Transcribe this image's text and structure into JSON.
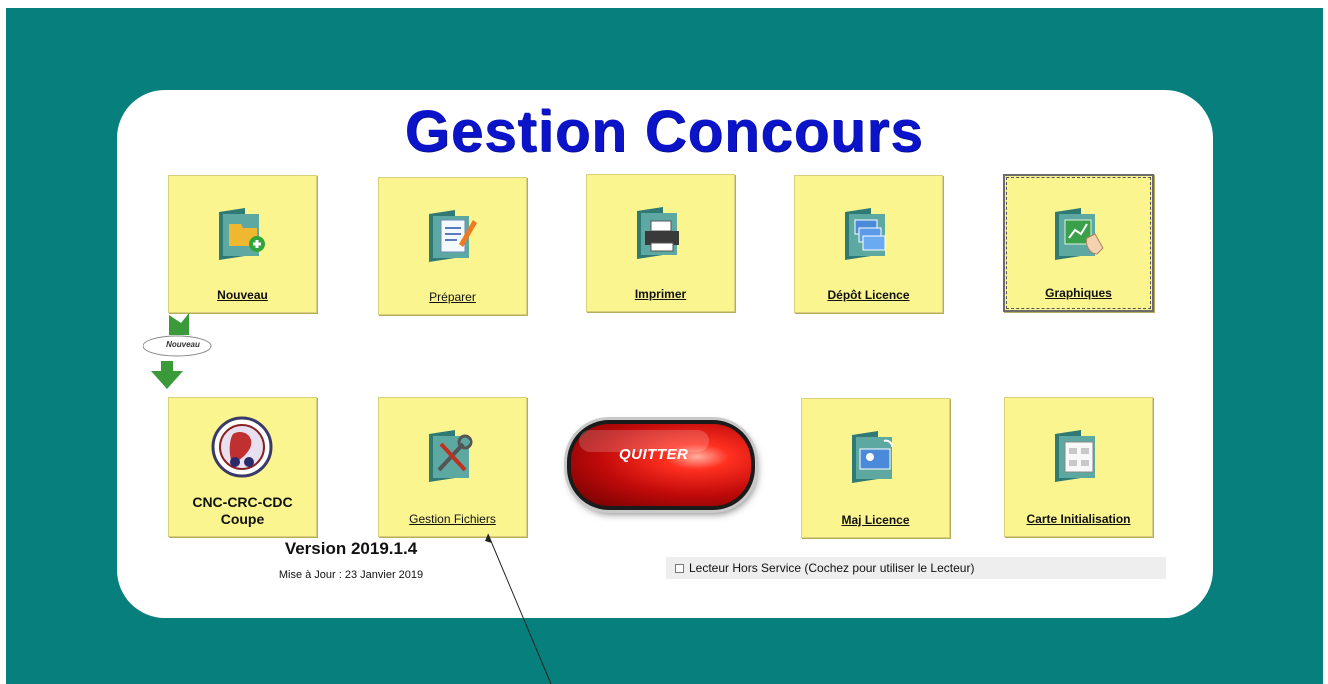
{
  "app": {
    "title": "Gestion Concours"
  },
  "tiles_row1": [
    {
      "label": "Nouveau",
      "icon": "new-folder-icon"
    },
    {
      "label": "Préparer",
      "icon": "edit-document-icon"
    },
    {
      "label": "Imprimer",
      "icon": "printer-icon"
    },
    {
      "label": "Dépôt Licence",
      "icon": "license-cards-icon"
    },
    {
      "label": "Graphiques",
      "icon": "chart-hand-icon"
    }
  ],
  "tiles_row2": [
    {
      "label_line1": "CNC-CRC-CDC",
      "label_line2": "Coupe",
      "icon": "federation-logo-icon"
    },
    {
      "label": "Gestion Fichiers",
      "icon": "tools-icon"
    },
    {
      "label": "Maj Licence",
      "icon": "id-card-icon"
    },
    {
      "label": "Carte Initialisation",
      "icon": "network-map-icon"
    }
  ],
  "new_badge": {
    "text": "Nouveau"
  },
  "quit": {
    "label": "QUITTER"
  },
  "version": {
    "text": "Version 2019.1.4",
    "update": "Mise à Jour : 23 Janvier 2019"
  },
  "lecteur": {
    "label": "Lecteur Hors Service (Cochez pour utiliser le Lecteur)",
    "checked": false
  },
  "colors": {
    "background": "#077f7c",
    "tile": "#fbf58f",
    "title": "#0b14c8",
    "quit_button": "#c00a0a"
  }
}
